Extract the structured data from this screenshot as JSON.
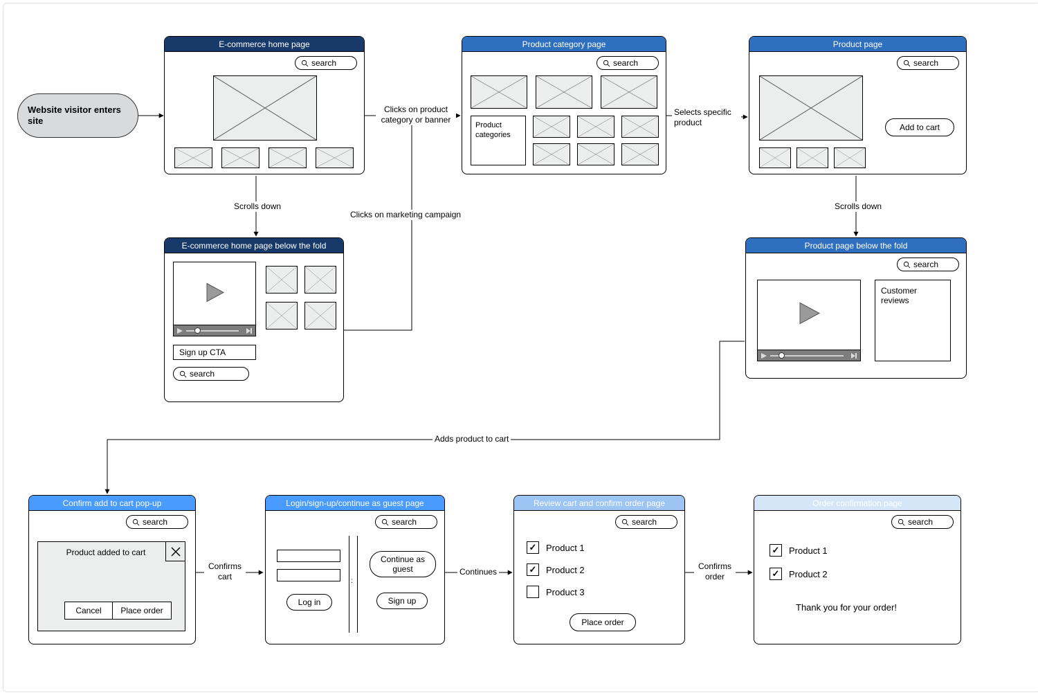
{
  "start": {
    "label": "Website visitor enters site"
  },
  "edges": {
    "e1": "Clicks on product category or banner",
    "e2": "Selects specific product",
    "e3_a": "Scrolls down",
    "e3_b": "Scrolls down",
    "e4": "Clicks on marketing campaign",
    "e5": "Adds product to cart",
    "e6": "Confirms cart",
    "e7": "Continues",
    "e8": "Confirms order"
  },
  "frames": {
    "home": {
      "title": "E-commerce home page",
      "search": "search"
    },
    "homeBelow": {
      "title": "E-commerce home page below the fold",
      "search": "search",
      "signup_cta": "Sign up CTA"
    },
    "category": {
      "title": "Product category page",
      "search": "search",
      "sidebar_label": "Product categories"
    },
    "product": {
      "title": "Product page",
      "search": "search",
      "add_to_cart": "Add to cart"
    },
    "productBelow": {
      "title": "Product page below the fold",
      "search": "search",
      "reviews": "Customer reviews"
    },
    "confirmAdd": {
      "title": "Confirm add to cart pop-up",
      "search": "search",
      "popup_text": "Product added to cart",
      "cancel": "Cancel",
      "place": "Place order"
    },
    "login": {
      "title": "Login/sign-up/continue as guest page",
      "search": "search",
      "login_btn": "Log in",
      "guest_btn": "Continue as guest",
      "signup_btn": "Sign up"
    },
    "review": {
      "title": "Review cart and confirm order page",
      "search": "search",
      "items": [
        "Product 1",
        "Product 2",
        "Product 3"
      ],
      "checked": [
        true,
        true,
        false
      ],
      "place": "Place order"
    },
    "confirmation": {
      "title": "Order confirmation page",
      "search": "search",
      "items": [
        "Product 1",
        "Product 2"
      ],
      "thanks": "Thank you for your order!"
    }
  }
}
